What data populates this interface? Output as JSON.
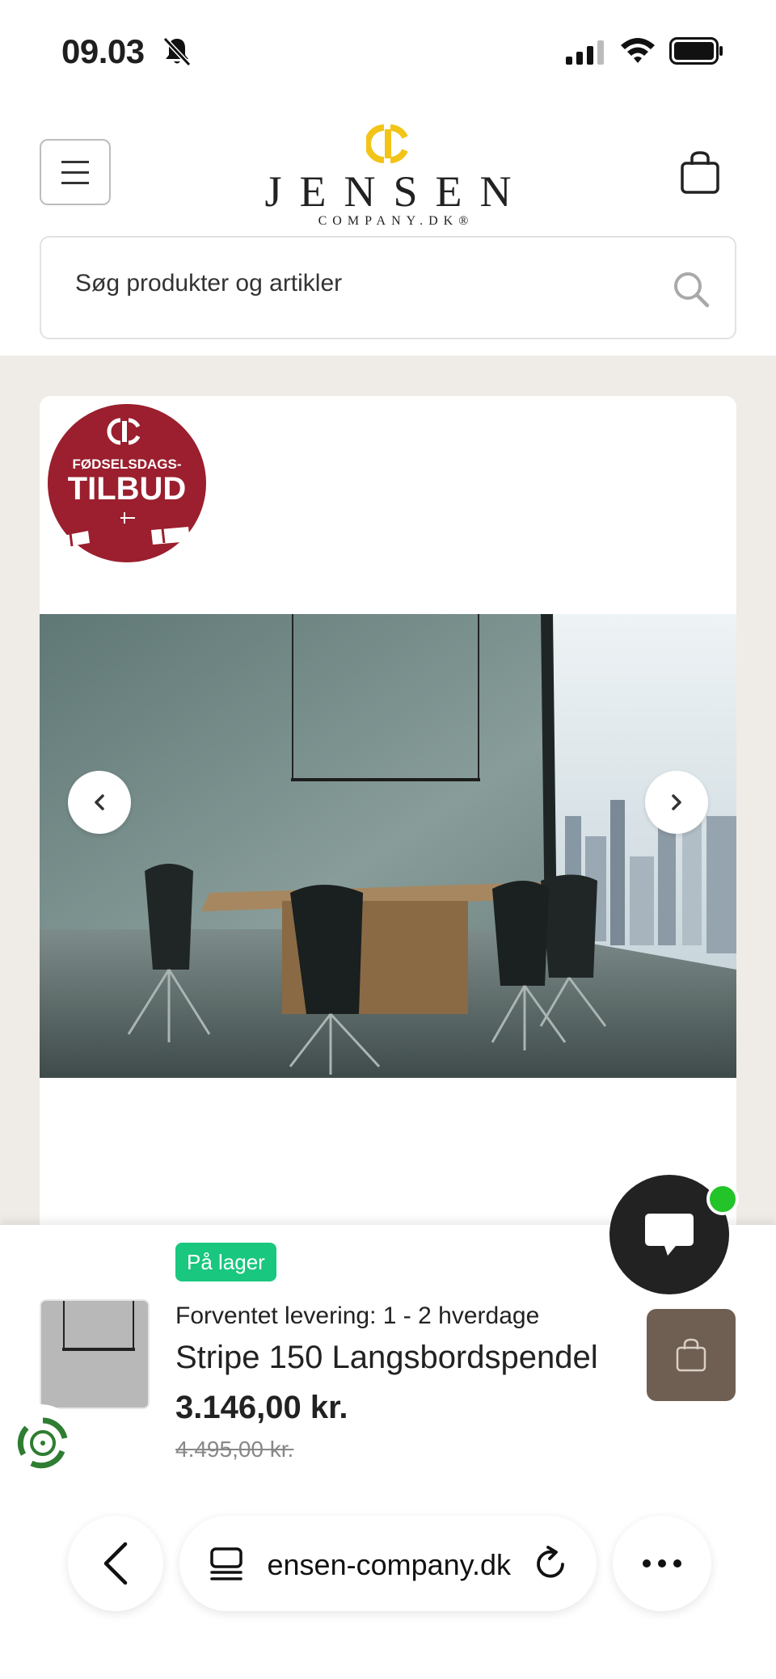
{
  "status_bar": {
    "time": "09.03"
  },
  "header": {
    "logo": {
      "name": "JENSEN",
      "sub": "COMPANY.DK®",
      "accent": "#f2c418"
    },
    "search": {
      "placeholder": "Søg produkter og artikler"
    }
  },
  "product": {
    "badge": {
      "line1": "FØDSELSDAGS-",
      "line2": "TILBUD",
      "color": "#9b1f2e"
    }
  },
  "sticky_bar": {
    "stock_label": "På lager",
    "stock_color": "#19c77f",
    "delivery": "Forventet levering: 1 - 2 hverdage",
    "title": "Stripe 150 Langsbordspendel",
    "price": "3.146,00 kr.",
    "old_price": "4.495,00 kr.",
    "cart_color": "#6f5f52"
  },
  "browser": {
    "url": "jensen-company.dk"
  }
}
